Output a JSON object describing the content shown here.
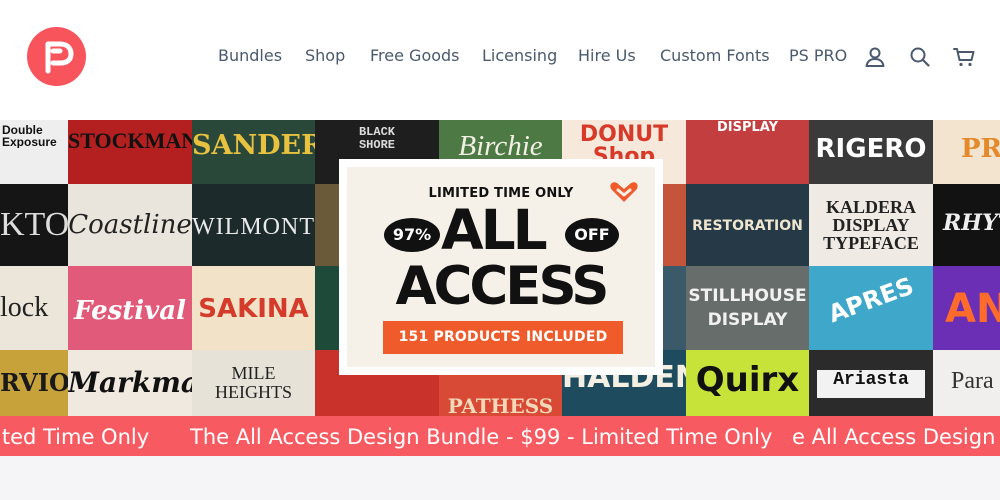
{
  "nav": {
    "items": [
      {
        "label": "Bundles"
      },
      {
        "label": "Shop"
      },
      {
        "label": "Free Goods"
      },
      {
        "label": "Licensing"
      },
      {
        "label": "Hire Us"
      },
      {
        "label": "Custom Fonts"
      },
      {
        "label": "PS PRO"
      }
    ],
    "icons": [
      "account-icon",
      "search-icon",
      "cart-icon"
    ]
  },
  "colors": {
    "brand": "#f7545c",
    "nav_text": "#4a5a6c",
    "ticker_bg": "#f75a60",
    "promo_button": "#ef5b2b"
  },
  "hero": {
    "tiles": [
      {
        "label": "Double Exposure"
      },
      {
        "label": "STOCKMAN"
      },
      {
        "label": "SANDERO"
      },
      {
        "label": "BLACK SHORE"
      },
      {
        "label": "Birchie"
      },
      {
        "label": "DONUT Shop"
      },
      {
        "label": "DISPLAY"
      },
      {
        "label": "RIGERO"
      },
      {
        "label": "PRI"
      },
      {
        "label": "KTON"
      },
      {
        "label": "Coastline"
      },
      {
        "label": "WILMONT"
      },
      {
        "label": "RESTORATION"
      },
      {
        "label": "KALDERA DISPLAY TYPEFACE"
      },
      {
        "label": "RHYT"
      },
      {
        "label": "lock"
      },
      {
        "label": "Festival"
      },
      {
        "label": "SAKINA"
      },
      {
        "label": "STILLHOUSE DISPLAY"
      },
      {
        "label": "APRES"
      },
      {
        "label": "AN"
      },
      {
        "label": "RVIO"
      },
      {
        "label": "Markmano"
      },
      {
        "label": "MILE HEIGHTS"
      },
      {
        "label": "PATHESS"
      },
      {
        "label": "HALDEN"
      },
      {
        "label": "Quirx"
      },
      {
        "label": "Ariasta"
      },
      {
        "label": "Para"
      }
    ]
  },
  "promo": {
    "top_text": "LIMITED TIME ONLY",
    "discount": "97%",
    "line1": "ALL",
    "off": "OFF",
    "line2": "ACCESS",
    "button": "151 PRODUCTS INCLUDED"
  },
  "ticker": {
    "segment_left": "ited Time Only",
    "segment_main": "The All Access Design Bundle - $99 - Limited Time Only",
    "segment_right": "e All Access Design"
  }
}
